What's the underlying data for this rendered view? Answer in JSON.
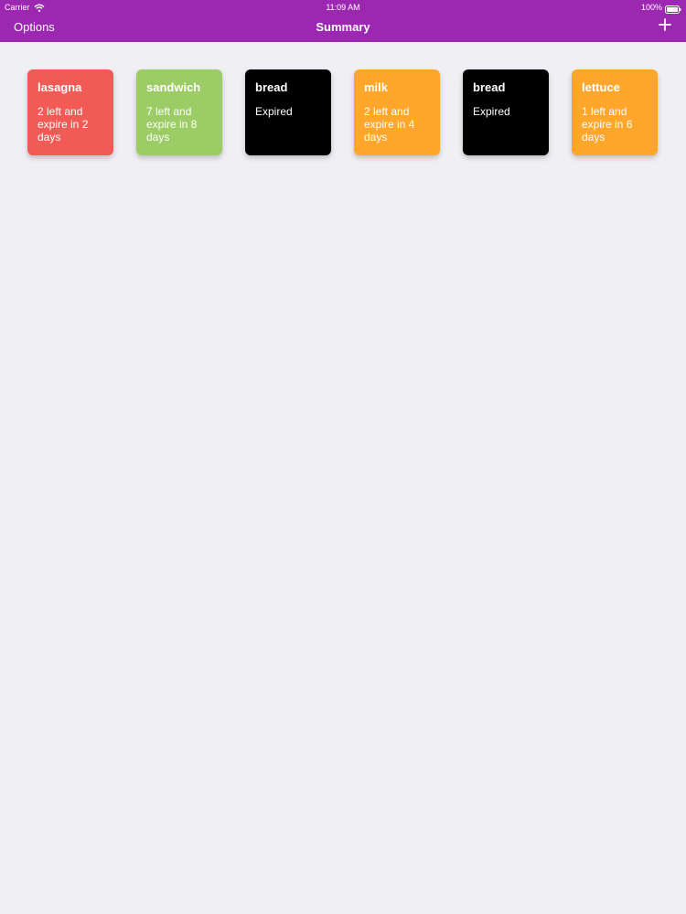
{
  "status_bar": {
    "carrier": "Carrier",
    "time": "11:09 AM",
    "battery": "100%"
  },
  "nav": {
    "left": "Options",
    "title": "Summary",
    "add_icon": "plus-icon"
  },
  "colors": {
    "header": "#9c27b0",
    "background": "#efeff4",
    "red": "#f25a56",
    "green": "#9ccc65",
    "black": "#000000",
    "orange": "#ffa62b"
  },
  "items": [
    {
      "name": "lasagna",
      "status": "2 left and expire in 2 days",
      "color": "#f25a56"
    },
    {
      "name": "sandwich",
      "status": "7 left and expire in 8 days",
      "color": "#9ccc65"
    },
    {
      "name": "bread",
      "status": "Expired",
      "color": "#000000"
    },
    {
      "name": "milk",
      "status": "2 left and expire in 4 days",
      "color": "#ffa62b"
    },
    {
      "name": "bread",
      "status": "Expired",
      "color": "#000000"
    },
    {
      "name": "lettuce",
      "status": "1 left and expire in 6 days",
      "color": "#ffa62b"
    }
  ]
}
